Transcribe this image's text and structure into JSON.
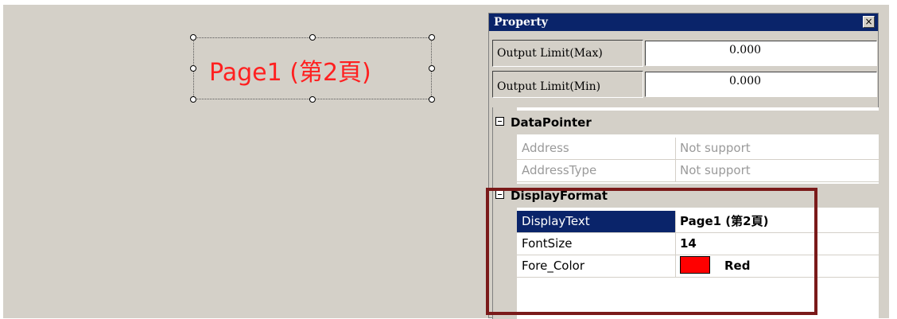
{
  "canvas": {
    "label_text": "Page1 (第2頁)",
    "label_color": "#ff2020"
  },
  "property_window": {
    "title": "Property",
    "close_glyph": "×",
    "fields": [
      {
        "label": "Output Limit(Max)",
        "value": "0.000"
      },
      {
        "label": "Output Limit(Min)",
        "value": "0.000"
      }
    ],
    "sections": [
      {
        "name": "DataPointer",
        "rows": [
          {
            "key": "Address",
            "value": "Not support"
          },
          {
            "key": "AddressType",
            "value": "Not support"
          }
        ]
      },
      {
        "name": "DisplayFormat",
        "rows": [
          {
            "key": "DisplayText",
            "value": "Page1 (第2頁)"
          },
          {
            "key": "FontSize",
            "value": "14"
          },
          {
            "key": "Fore_Color",
            "value": "Red",
            "swatch_color": "#ff0000"
          }
        ]
      }
    ],
    "accent_color": "#0a246a",
    "highlight_color": "#7a1a1a"
  }
}
